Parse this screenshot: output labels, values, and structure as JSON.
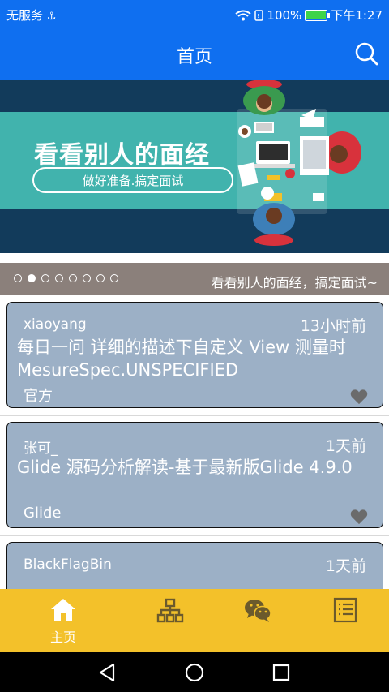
{
  "statusbar": {
    "carrier": "无服务",
    "battery": "100%",
    "time": "下午1:27"
  },
  "appbar": {
    "title": "首页"
  },
  "banner": {
    "title": "看看别人的面经",
    "subtitle": "做好准备.搞定面试"
  },
  "carousel": {
    "caption": "看看别人的面经，搞定面试~",
    "dot_count": 8,
    "active_index": 1
  },
  "articles": [
    {
      "author": "xiaoyang",
      "time": "13小时前",
      "title": "每日一问  详细的描述下自定义 View 测量时 MesureSpec.UNSPECIFIED",
      "tag": "官方"
    },
    {
      "author": "张可_",
      "time": "1天前",
      "title": "Glide 源码分析解读-基于最新版Glide 4.9.0",
      "tag": "Glide"
    },
    {
      "author": "BlackFlagBin",
      "time": "1天前",
      "title": "",
      "tag": ""
    }
  ],
  "bottom_nav": [
    {
      "label": "主页",
      "icon": "home-icon",
      "selected": true
    },
    {
      "label": "",
      "icon": "sitemap-icon",
      "selected": false
    },
    {
      "label": "",
      "icon": "wechat-icon",
      "selected": false
    },
    {
      "label": "",
      "icon": "list-icon",
      "selected": false
    }
  ],
  "colors": {
    "primary": "#0f6ff0",
    "accent": "#f3c12a",
    "card": "#9cb0c6",
    "banner_band": "#41b3ad",
    "banner_bg": "#123b5b"
  }
}
